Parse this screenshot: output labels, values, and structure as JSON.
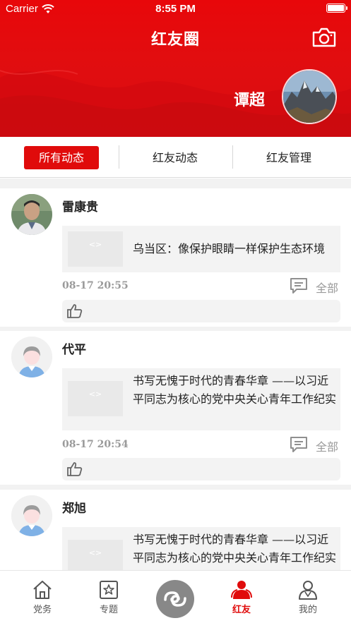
{
  "status_bar": {
    "carrier": "Carrier",
    "time": "8:55 PM"
  },
  "header": {
    "title": "红友圈",
    "username": "谭超"
  },
  "tabs": [
    {
      "label": "所有动态",
      "active": true
    },
    {
      "label": "红友动态",
      "active": false
    },
    {
      "label": "红友管理",
      "active": false
    }
  ],
  "posts": [
    {
      "author": "雷康贵",
      "content": "乌当区：像保护眼睛一样保护生态环境",
      "time": "08-17 20:55",
      "all_label": "全部"
    },
    {
      "author": "代平",
      "content": "书写无愧于时代的青春华章 ——以习近平同志为核心的党中央关心青年工作纪实",
      "time": "08-17 20:54",
      "all_label": "全部"
    },
    {
      "author": "郑旭",
      "content": "书写无愧于时代的青春华章 ——以习近平同志为核心的党中央关心青年工作纪实"
    }
  ],
  "tabbar": [
    {
      "label": "党务",
      "icon": "house-icon",
      "active": false
    },
    {
      "label": "专题",
      "icon": "star-badge-icon",
      "active": false
    },
    {
      "label": "",
      "icon": "swirl-logo-icon",
      "active": false
    },
    {
      "label": "红友",
      "icon": "people-icon",
      "active": true
    },
    {
      "label": "我的",
      "icon": "person-icon",
      "active": false
    }
  ],
  "colors": {
    "accent": "#e00b0b",
    "muted_text": "#9a9a9a",
    "card_bg": "#f3f3f3"
  }
}
